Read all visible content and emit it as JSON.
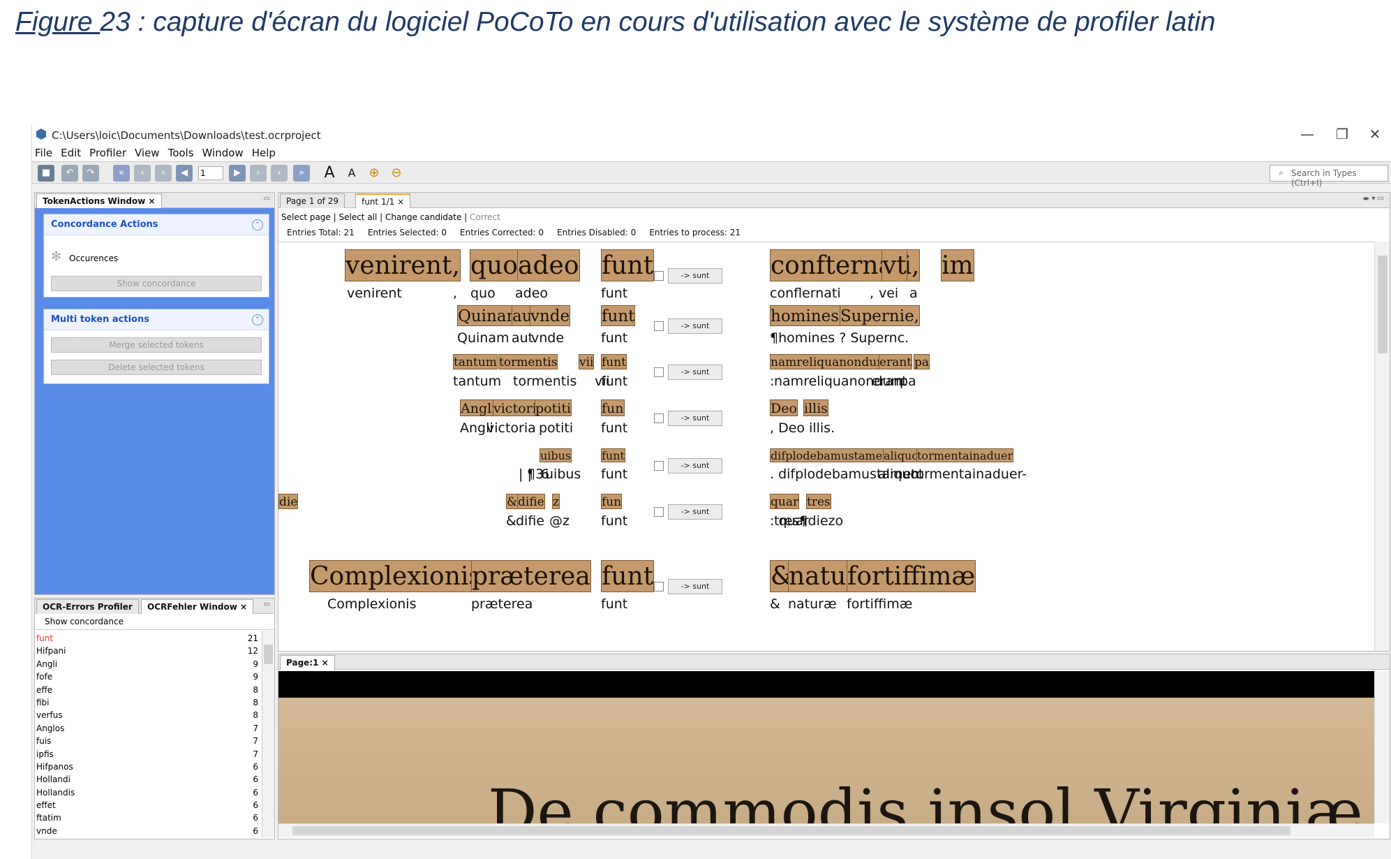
{
  "caption": {
    "label": "Figure ",
    "text": "23 : capture d'écran du logiciel PoCoTo en cours d'utilisation avec le système de profiler latin"
  },
  "window": {
    "path": "C:\\Users\\loic\\Documents\\Downloads\\test.ocrproject",
    "min": "—",
    "restore": "❐",
    "close": "✕"
  },
  "menu": [
    "File",
    "Edit",
    "Profiler",
    "View",
    "Tools",
    "Window",
    "Help"
  ],
  "toolbar": {
    "page_input": "1",
    "search_placeholder": "Search in Types (Ctrl+I)"
  },
  "left_panel": {
    "tab": "TokenActions Window",
    "close": "×",
    "concordance": {
      "title": "Concordance Actions",
      "occurences": "Occurences",
      "show": "Show concordance"
    },
    "multi": {
      "title": "Multi token actions",
      "merge": "Merge selected tokens",
      "delete": "Delete selected tokens"
    }
  },
  "errors_panel": {
    "tab1": "OCR-Errors Profiler",
    "tab2": "OCRFehler Window",
    "close": "×",
    "show": "Show concordance",
    "items": [
      {
        "w": "funt",
        "c": "21"
      },
      {
        "w": "Hifpani",
        "c": "12"
      },
      {
        "w": "Angli",
        "c": "9"
      },
      {
        "w": "fofe",
        "c": "9"
      },
      {
        "w": "effe",
        "c": "8"
      },
      {
        "w": "fibi",
        "c": "8"
      },
      {
        "w": "verfus",
        "c": "8"
      },
      {
        "w": "Anglos",
        "c": "7"
      },
      {
        "w": "fuis",
        "c": "7"
      },
      {
        "w": "ipfis",
        "c": "7"
      },
      {
        "w": "Hifpanos",
        "c": "6"
      },
      {
        "w": "Hollandi",
        "c": "6"
      },
      {
        "w": "Hollandis",
        "c": "6"
      },
      {
        "w": "effet",
        "c": "6"
      },
      {
        "w": "ftatim",
        "c": "6"
      },
      {
        "w": "vnde",
        "c": "6"
      }
    ]
  },
  "conc": {
    "tab1": "Page 1 of 29",
    "tab2": "funt 1/1",
    "close": "×",
    "select_page": "Select page",
    "select_all": "Select all",
    "change": "Change candidate",
    "correct": "Correct",
    "entries_total": "Entries Total: 21",
    "entries_selected": "Entries Selected: 0",
    "entries_corrected": "Entries Corrected: 0",
    "entries_disabled": "Entries Disabled: 0",
    "entries_process": "Entries to process: 21",
    "sunt": "-> sunt",
    "rows": [
      {
        "left": [
          "venirent",
          ",",
          "quo",
          "adeo"
        ],
        "center": "funt",
        "right": [
          "conflernati",
          ",",
          "vei",
          "a"
        ]
      },
      {
        "left": [
          "Quinam",
          "aut",
          "vnde"
        ],
        "center": "funt",
        "right": [
          "¶homines ? Supernc."
        ]
      },
      {
        "left": [
          "tantum",
          "tormentis",
          "vii"
        ],
        "center": "funt",
        "right": [
          ":",
          "namreliquanondum",
          "erant",
          "pa"
        ]
      },
      {
        "left": [
          "Angli",
          "victoria",
          "potiti"
        ],
        "center": "funt",
        "right": [
          ", Deo illis."
        ]
      },
      {
        "left": [
          "| |",
          "¶3",
          "6",
          "uibus"
        ],
        "center": "funt",
        "right": [
          ". difplodebamustamen",
          "aliquot",
          "tormentainaduer-"
        ]
      },
      {
        "left": [
          "&",
          "difie",
          "@z"
        ],
        "center": "funt",
        "right": [
          ": quar",
          "tres¶diezo"
        ]
      },
      {
        "left": [
          "Complexionis",
          "præterea"
        ],
        "center": "funt",
        "right": [
          "&",
          "naturæ",
          "fortiffimæ"
        ]
      }
    ],
    "scans": [
      {
        "left": [
          "venirent,",
          "quo",
          "adeo"
        ],
        "center": "funt",
        "right": [
          "confternati,",
          "vt",
          "im"
        ]
      },
      {
        "left": [
          "Quinam",
          "aut",
          "vnde"
        ],
        "center": "funt",
        "right": [
          "homines:",
          "Supernie,"
        ]
      },
      {
        "left": [
          "tantum",
          "tormentis",
          "vii"
        ],
        "center": "funt",
        "right": [
          "namreliquanondum",
          "erant",
          "pa"
        ]
      },
      {
        "left": [
          "Angli",
          "victoria",
          "potiti"
        ],
        "center": "fun",
        "right": [
          "Deo",
          "illis"
        ]
      },
      {
        "left": [
          "uibus"
        ],
        "center": "funt",
        "right": [
          "difplodebamustamen",
          "aliquot",
          "tormentainaduer"
        ]
      },
      {
        "left": [
          "&",
          "difie",
          "z"
        ],
        "center": "fun",
        "right": [
          "quar",
          "tres",
          "die"
        ]
      },
      {
        "left": [
          "Complexionis",
          "præterea"
        ],
        "center": "funt",
        "right": [
          "&",
          "naturæ",
          "fortiffimæ"
        ]
      }
    ]
  },
  "page_panel": {
    "tab": "Page:1",
    "close": "×",
    "scan_text": "De commodis insol Virginiæ"
  }
}
